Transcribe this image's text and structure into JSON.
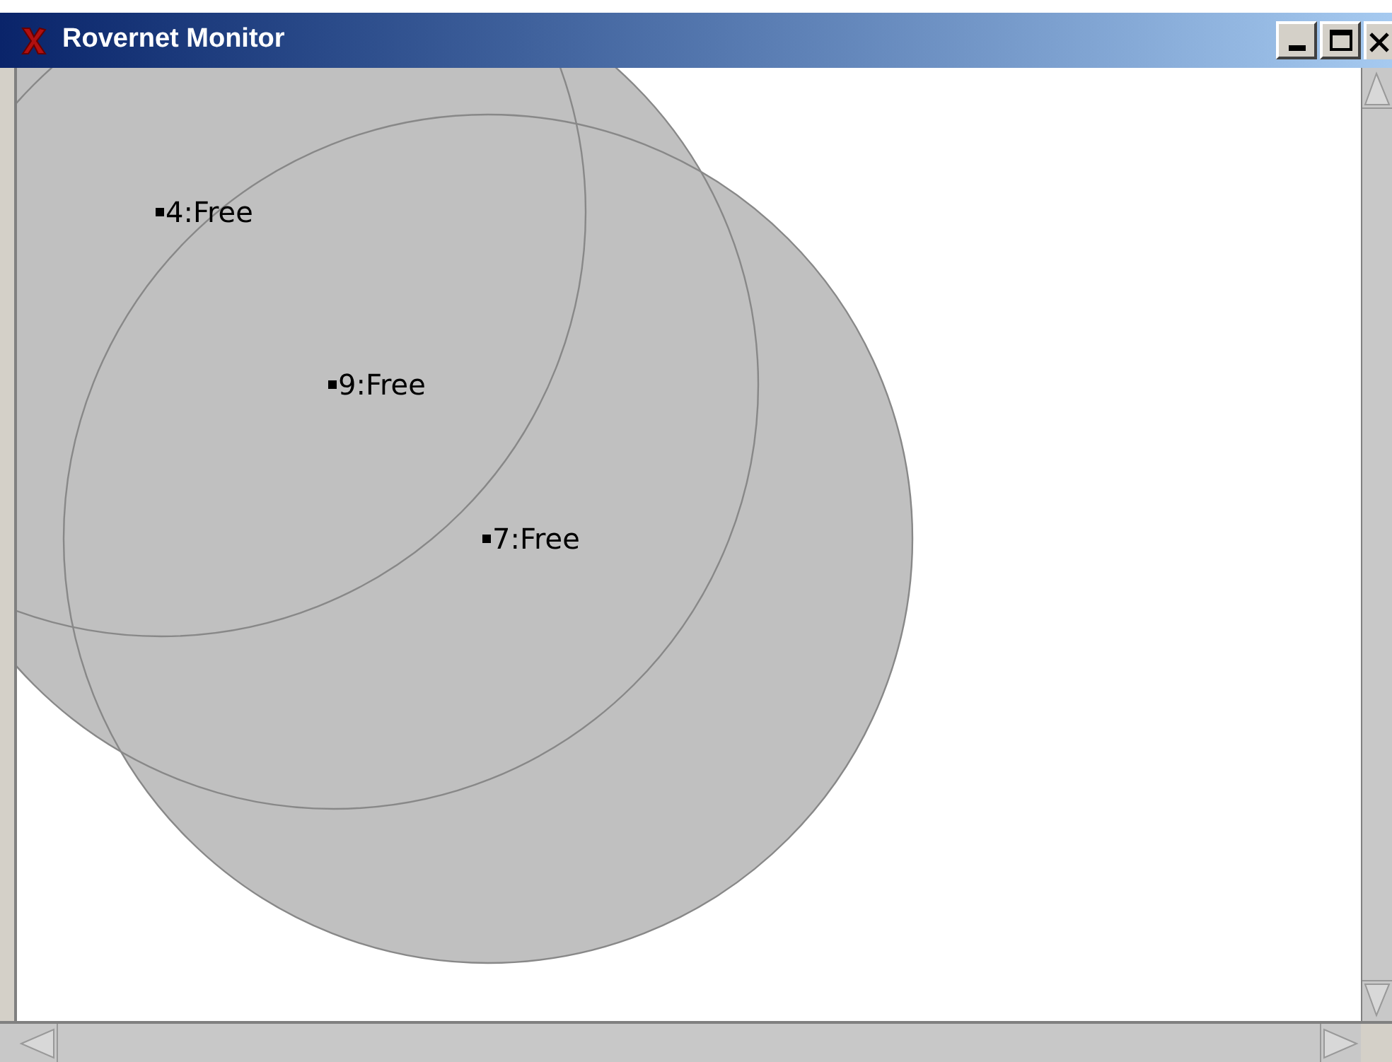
{
  "window": {
    "title": "Rovernet Monitor"
  },
  "nodes": [
    {
      "label": "4:Free"
    },
    {
      "label": "9:Free"
    },
    {
      "label": "7:Free"
    }
  ]
}
